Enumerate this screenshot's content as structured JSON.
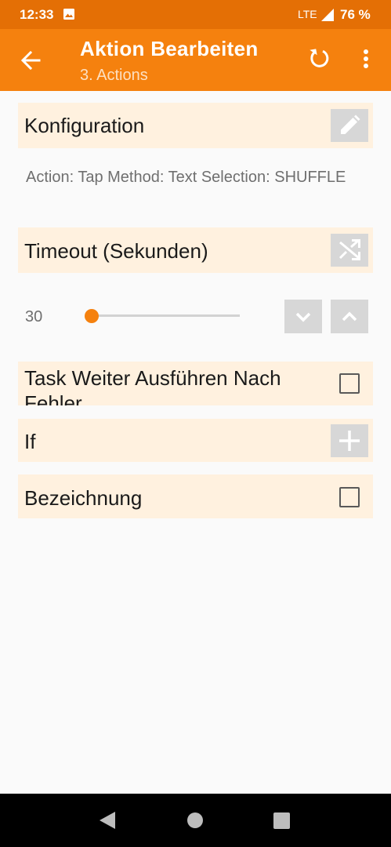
{
  "status_bar": {
    "time": "12:33",
    "network": "LTE",
    "battery": "76 %"
  },
  "app_bar": {
    "title": "Aktion Bearbeiten",
    "subtitle": "3. Actions"
  },
  "konfiguration": {
    "label": "Konfiguration",
    "description": "Action: Tap Method: Text Selection: SHUFFLE"
  },
  "timeout": {
    "label": "Timeout (Sekunden)",
    "value": "30",
    "slider_fraction": 0.0
  },
  "continue_after_error": {
    "label": "Task Weiter Ausführen Nach Fehler",
    "checked": false
  },
  "if_row": {
    "label": "If"
  },
  "bezeichnung": {
    "label": "Bezeichnung",
    "checked": false
  },
  "colors": {
    "status_bar": "#e46f05",
    "app_bar": "#f5810e",
    "row_background": "#fff1df",
    "button_gray": "#d7d7d7",
    "accent": "#f5810e"
  }
}
